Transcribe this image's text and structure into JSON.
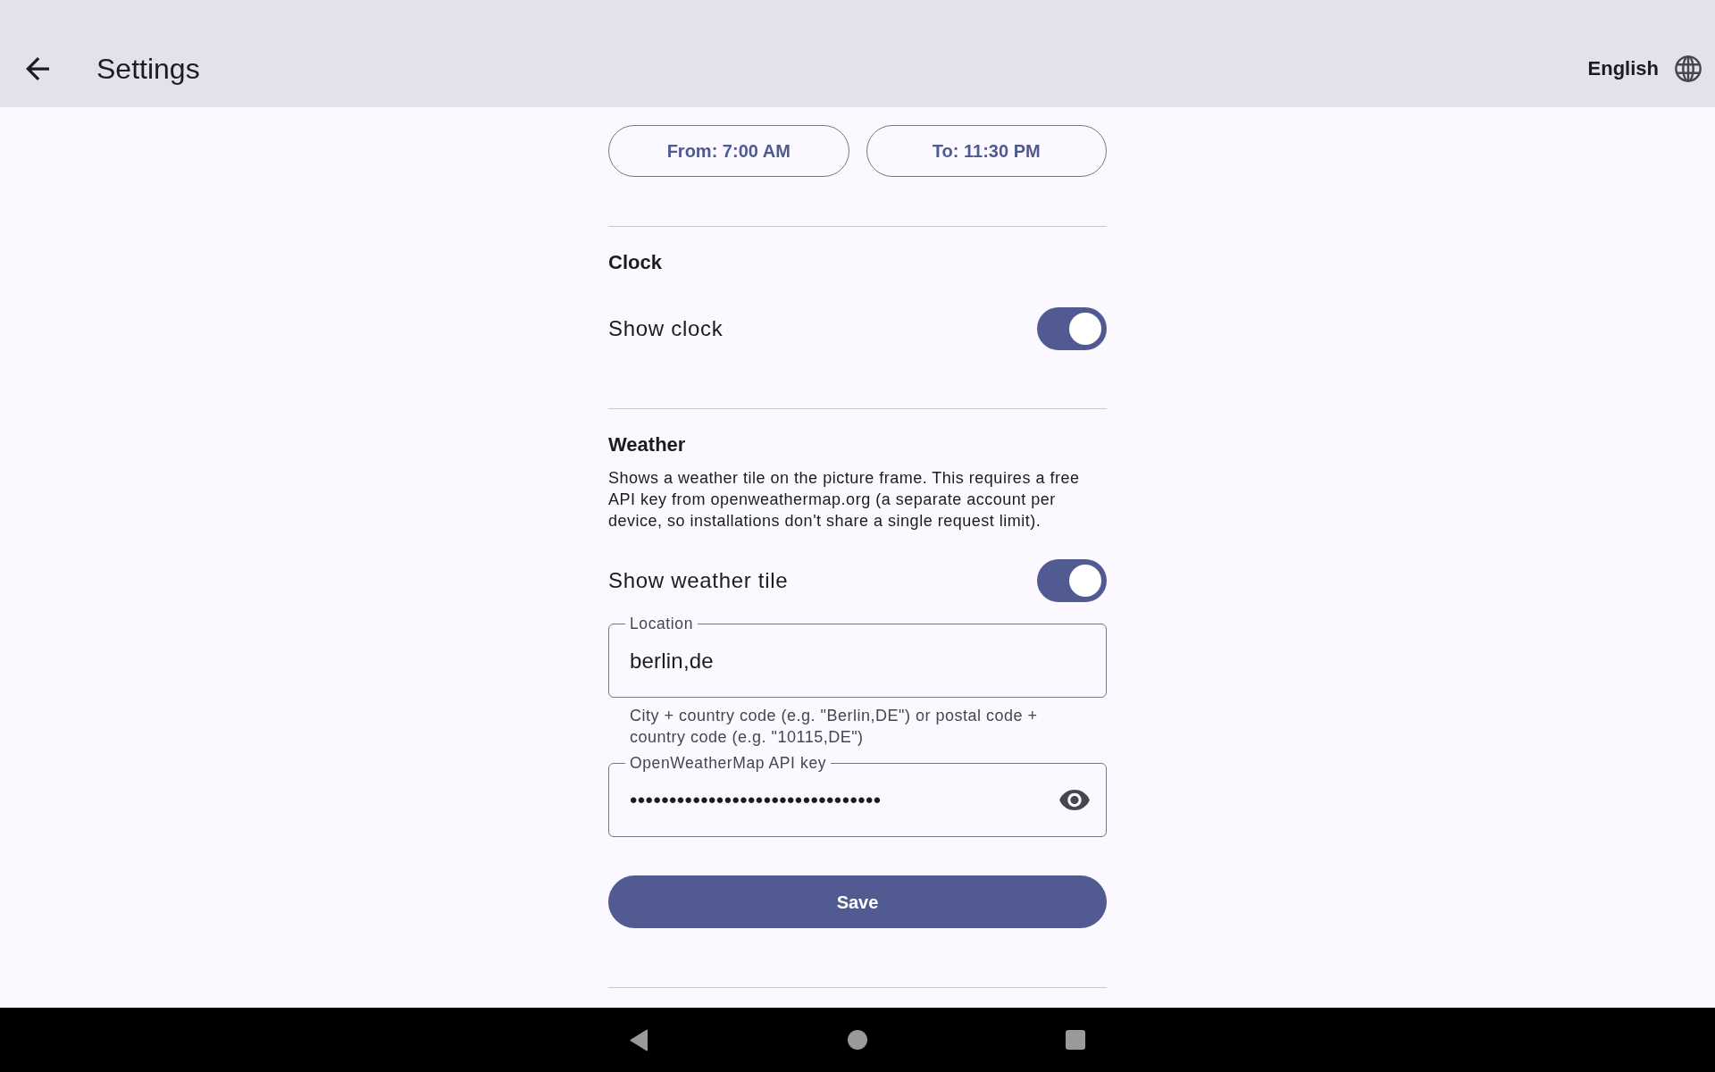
{
  "app_bar": {
    "title": "Settings",
    "language": "English"
  },
  "time_range": {
    "buttons": [
      {
        "label": "From: 7:00 AM"
      },
      {
        "label": "To: 11:30 PM"
      }
    ]
  },
  "clock": {
    "heading": "Clock",
    "toggle": {
      "label": "Show clock",
      "on": true
    }
  },
  "weather": {
    "heading": "Weather",
    "description": "Shows a weather tile on the picture frame. This requires a free API key from openweathermap.org (a separate account per device, so installations don't share a single request limit).",
    "toggle": {
      "label": "Show weather tile",
      "on": true
    },
    "location_field": {
      "label": "Location",
      "value": "berlin,de",
      "helper": "City + country code (e.g. \"Berlin,DE\") or postal code + country code (e.g. \"10115,DE\")"
    },
    "api_key_field": {
      "label": "OpenWeatherMap API key",
      "value": "••••••••••••••••••••••••••••••••"
    },
    "save_button": {
      "label": "Save"
    }
  }
}
